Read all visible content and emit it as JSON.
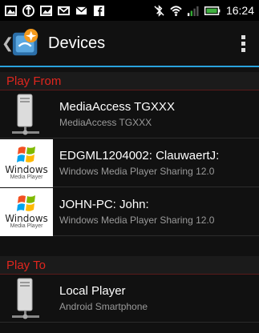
{
  "status_bar": {
    "time": "16:24",
    "icons": [
      "gallery-icon",
      "usb-icon",
      "image-icon",
      "gmail-icon",
      "mail-icon",
      "facebook-icon",
      "bluetooth-off-icon",
      "wifi-icon",
      "signal-icon",
      "battery-icon"
    ]
  },
  "action_bar": {
    "title": "Devices"
  },
  "sections": {
    "play_from": "Play From",
    "play_to": "Play To"
  },
  "play_from_devices": [
    {
      "name": "MediaAccess TGXXX",
      "subtitle": "MediaAccess TGXXX",
      "icon": "server-icon"
    },
    {
      "name": "EDGML1204002: ClauwaertJ:",
      "subtitle": "Windows Media Player Sharing  12.0",
      "icon": "windows-media-player-icon"
    },
    {
      "name": "JOHN-PC: John:",
      "subtitle": "Windows Media Player Sharing  12.0",
      "icon": "windows-media-player-icon"
    }
  ],
  "play_to_devices": [
    {
      "name": "Local Player",
      "subtitle": "Android Smartphone",
      "icon": "server-icon"
    }
  ],
  "wmp_logo": {
    "word": "Windows",
    "sub": "Media Player"
  },
  "colors": {
    "accent": "#2aa3dd",
    "section_header": "#e0261e"
  }
}
